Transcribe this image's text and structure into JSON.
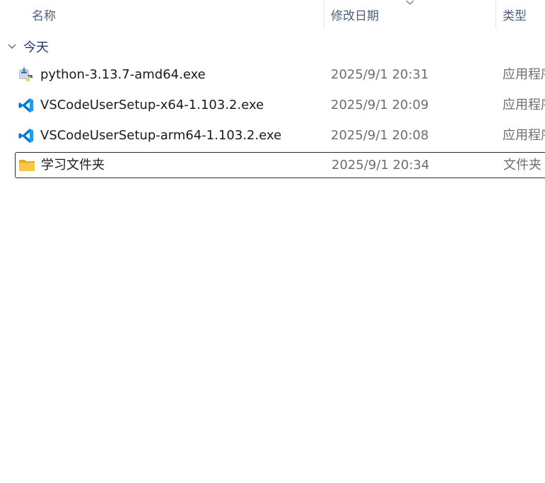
{
  "columns": {
    "name": "名称",
    "date": "修改日期",
    "type": "类型"
  },
  "group": {
    "label": "今天"
  },
  "files": [
    {
      "name": "python-3.13.7-amd64.exe",
      "date": "2025/9/1 20:31",
      "type": "应用程序",
      "icon": "python-installer-icon"
    },
    {
      "name": "VSCodeUserSetup-x64-1.103.2.exe",
      "date": "2025/9/1 20:09",
      "type": "应用程序",
      "icon": "vscode-icon"
    },
    {
      "name": "VSCodeUserSetup-arm64-1.103.2.exe",
      "date": "2025/9/1 20:08",
      "type": "应用程序",
      "icon": "vscode-icon"
    },
    {
      "name": "学习文件夹",
      "date": "2025/9/1 20:34",
      "type": "文件夹",
      "icon": "folder-icon"
    }
  ],
  "colors": {
    "header_text": "#4c607a",
    "group_text": "#1f3a68",
    "vscode_blue": "#0078d4",
    "folder_yellow": "#f8c74a"
  }
}
